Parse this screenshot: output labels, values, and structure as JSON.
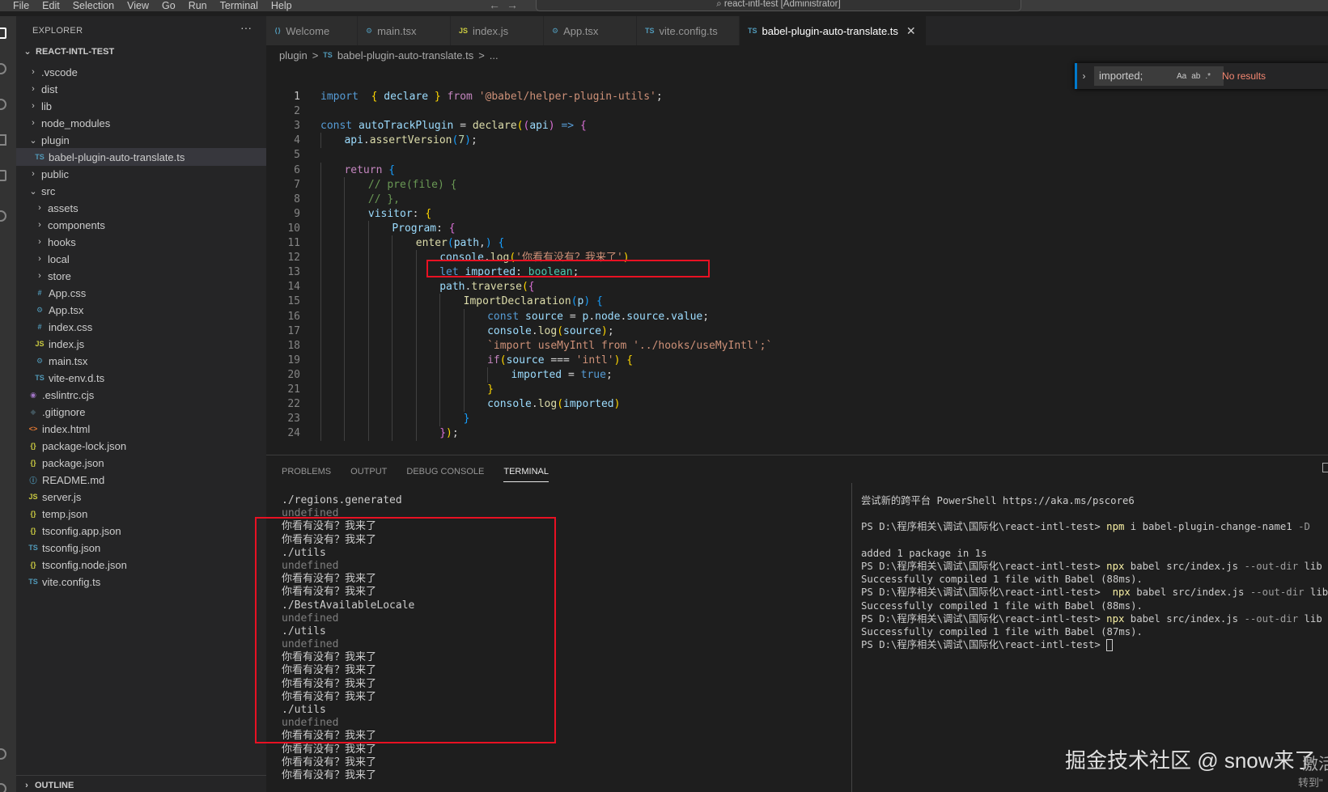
{
  "menubar": {
    "items": [
      "File",
      "Edit",
      "Selection",
      "View",
      "Go",
      "Run",
      "Terminal",
      "Help"
    ],
    "command_center": "react-intl-test [Administrator]"
  },
  "sidebar": {
    "title": "EXPLORER",
    "more": "···",
    "root": "REACT-INTL-TEST",
    "tree": [
      {
        "label": ".vscode",
        "type": "folder",
        "expanded": false,
        "depth": 0
      },
      {
        "label": "dist",
        "type": "folder",
        "expanded": false,
        "depth": 0
      },
      {
        "label": "lib",
        "type": "folder",
        "expanded": false,
        "depth": 0
      },
      {
        "label": "node_modules",
        "type": "folder",
        "expanded": false,
        "depth": 0
      },
      {
        "label": "plugin",
        "type": "folder",
        "expanded": true,
        "depth": 0
      },
      {
        "label": "babel-plugin-auto-translate.ts",
        "type": "file",
        "icon": "TS",
        "iconclass": "ic-ts",
        "depth": 1,
        "selected": true
      },
      {
        "label": "public",
        "type": "folder",
        "expanded": false,
        "depth": 0
      },
      {
        "label": "src",
        "type": "folder",
        "expanded": true,
        "depth": 0
      },
      {
        "label": "assets",
        "type": "folder",
        "expanded": false,
        "depth": 1
      },
      {
        "label": "components",
        "type": "folder",
        "expanded": false,
        "depth": 1
      },
      {
        "label": "hooks",
        "type": "folder",
        "expanded": false,
        "depth": 1
      },
      {
        "label": "local",
        "type": "folder",
        "expanded": false,
        "depth": 1
      },
      {
        "label": "store",
        "type": "folder",
        "expanded": false,
        "depth": 1
      },
      {
        "label": "App.css",
        "type": "file",
        "icon": "#",
        "iconclass": "ic-css",
        "depth": 1
      },
      {
        "label": "App.tsx",
        "type": "file",
        "icon": "⚙",
        "iconclass": "ic-tsx",
        "depth": 1
      },
      {
        "label": "index.css",
        "type": "file",
        "icon": "#",
        "iconclass": "ic-css",
        "depth": 1
      },
      {
        "label": "index.js",
        "type": "file",
        "icon": "JS",
        "iconclass": "ic-js",
        "depth": 1
      },
      {
        "label": "main.tsx",
        "type": "file",
        "icon": "⚙",
        "iconclass": "ic-tsx",
        "depth": 1
      },
      {
        "label": "vite-env.d.ts",
        "type": "file",
        "icon": "TS",
        "iconclass": "ic-ts",
        "depth": 1
      },
      {
        "label": ".eslintrc.cjs",
        "type": "file",
        "icon": "◉",
        "iconclass": "ic-eslint",
        "depth": 0
      },
      {
        "label": ".gitignore",
        "type": "file",
        "icon": "◆",
        "iconclass": "ic-git",
        "depth": 0
      },
      {
        "label": "index.html",
        "type": "file",
        "icon": "<>",
        "iconclass": "ic-html",
        "depth": 0
      },
      {
        "label": "package-lock.json",
        "type": "file",
        "icon": "{}",
        "iconclass": "ic-json",
        "depth": 0
      },
      {
        "label": "package.json",
        "type": "file",
        "icon": "{}",
        "iconclass": "ic-json",
        "depth": 0
      },
      {
        "label": "README.md",
        "type": "file",
        "icon": "ⓘ",
        "iconclass": "ic-info",
        "depth": 0
      },
      {
        "label": "server.js",
        "type": "file",
        "icon": "JS",
        "iconclass": "ic-js",
        "depth": 0
      },
      {
        "label": "temp.json",
        "type": "file",
        "icon": "{}",
        "iconclass": "ic-json",
        "depth": 0
      },
      {
        "label": "tsconfig.app.json",
        "type": "file",
        "icon": "{}",
        "iconclass": "ic-json",
        "depth": 0
      },
      {
        "label": "tsconfig.json",
        "type": "file",
        "icon": "TS",
        "iconclass": "ic-ts",
        "depth": 0
      },
      {
        "label": "tsconfig.node.json",
        "type": "file",
        "icon": "{}",
        "iconclass": "ic-json",
        "depth": 0
      },
      {
        "label": "vite.config.ts",
        "type": "file",
        "icon": "TS",
        "iconclass": "ic-ts",
        "depth": 0
      }
    ],
    "outline": "OUTLINE"
  },
  "tabs": [
    {
      "label": "Welcome",
      "icon": "⟨⟩",
      "active": false
    },
    {
      "label": "main.tsx",
      "icon": "⚙",
      "active": false
    },
    {
      "label": "index.js",
      "icon": "JS",
      "active": false
    },
    {
      "label": "App.tsx",
      "icon": "⚙",
      "active": false
    },
    {
      "label": "vite.config.ts",
      "icon": "TS",
      "active": false
    },
    {
      "label": "babel-plugin-auto-translate.ts",
      "icon": "TS",
      "active": true
    }
  ],
  "breadcrumb": [
    "plugin",
    ">",
    "TS",
    "babel-plugin-auto-translate.ts",
    ">",
    "..."
  ],
  "find": {
    "query": "imported;",
    "options": [
      "Aa",
      "ab",
      ".*"
    ],
    "result": "No results"
  },
  "editor": {
    "current_line": 1,
    "lines": [
      {
        "n": 1,
        "indent": 0,
        "tokens": [
          [
            "k",
            "import"
          ],
          [
            "p",
            "  "
          ],
          [
            "b1",
            "{"
          ],
          [
            "p",
            " "
          ],
          [
            "v",
            "declare"
          ],
          [
            "p",
            " "
          ],
          [
            "b1",
            "}"
          ],
          [
            "p",
            " "
          ],
          [
            "kc",
            "from"
          ],
          [
            "p",
            " "
          ],
          [
            "s",
            "'@babel/helper-plugin-utils'"
          ],
          [
            "p",
            ";"
          ]
        ]
      },
      {
        "n": 2,
        "indent": 0,
        "tokens": []
      },
      {
        "n": 3,
        "indent": 0,
        "tokens": [
          [
            "k",
            "const"
          ],
          [
            "p",
            " "
          ],
          [
            "v",
            "autoTrackPlugin"
          ],
          [
            "p",
            " = "
          ],
          [
            "f",
            "declare"
          ],
          [
            "b1",
            "("
          ],
          [
            "b2",
            "("
          ],
          [
            "v",
            "api"
          ],
          [
            "b2",
            ")"
          ],
          [
            "p",
            " "
          ],
          [
            "k",
            "=>"
          ],
          [
            "p",
            " "
          ],
          [
            "b2",
            "{"
          ]
        ]
      },
      {
        "n": 4,
        "indent": 1,
        "tokens": [
          [
            "v",
            "api"
          ],
          [
            "p",
            "."
          ],
          [
            "f",
            "assertVersion"
          ],
          [
            "b3",
            "("
          ],
          [
            "n",
            "7"
          ],
          [
            "b3",
            ")"
          ],
          [
            "p",
            ";"
          ]
        ]
      },
      {
        "n": 5,
        "indent": 0,
        "tokens": []
      },
      {
        "n": 6,
        "indent": 1,
        "tokens": [
          [
            "kc",
            "return"
          ],
          [
            "p",
            " "
          ],
          [
            "b3",
            "{"
          ]
        ]
      },
      {
        "n": 7,
        "indent": 2,
        "tokens": [
          [
            "c",
            "// pre(file) {"
          ]
        ]
      },
      {
        "n": 8,
        "indent": 2,
        "tokens": [
          [
            "c",
            "// },"
          ]
        ]
      },
      {
        "n": 9,
        "indent": 2,
        "tokens": [
          [
            "v",
            "visitor"
          ],
          [
            "p",
            ": "
          ],
          [
            "b1",
            "{"
          ]
        ]
      },
      {
        "n": 10,
        "indent": 3,
        "tokens": [
          [
            "v",
            "Program"
          ],
          [
            "p",
            ": "
          ],
          [
            "b2",
            "{"
          ]
        ]
      },
      {
        "n": 11,
        "indent": 4,
        "tokens": [
          [
            "f",
            "enter"
          ],
          [
            "b3",
            "("
          ],
          [
            "v",
            "path"
          ],
          [
            "p",
            ","
          ],
          [
            "b3",
            ")"
          ],
          [
            "p",
            " "
          ],
          [
            "b3",
            "{"
          ]
        ]
      },
      {
        "n": 12,
        "indent": 5,
        "tokens": [
          [
            "v",
            "console"
          ],
          [
            "p",
            "."
          ],
          [
            "f",
            "log"
          ],
          [
            "b1",
            "("
          ],
          [
            "s",
            "'你看有没有？我来了'"
          ],
          [
            "b1",
            ")"
          ]
        ]
      },
      {
        "n": 13,
        "indent": 5,
        "tokens": [
          [
            "k",
            "let"
          ],
          [
            "p",
            " "
          ],
          [
            "v",
            "imported"
          ],
          [
            "p",
            ": "
          ],
          [
            "t",
            "boolean"
          ],
          [
            "p",
            ";"
          ]
        ]
      },
      {
        "n": 14,
        "indent": 5,
        "tokens": [
          [
            "v",
            "path"
          ],
          [
            "p",
            "."
          ],
          [
            "f",
            "traverse"
          ],
          [
            "b1",
            "("
          ],
          [
            "b2",
            "{"
          ]
        ]
      },
      {
        "n": 15,
        "indent": 6,
        "tokens": [
          [
            "f",
            "ImportDeclaration"
          ],
          [
            "b3",
            "("
          ],
          [
            "v",
            "p"
          ],
          [
            "b3",
            ")"
          ],
          [
            "p",
            " "
          ],
          [
            "b3",
            "{"
          ]
        ]
      },
      {
        "n": 16,
        "indent": 7,
        "tokens": [
          [
            "k",
            "const"
          ],
          [
            "p",
            " "
          ],
          [
            "v",
            "source"
          ],
          [
            "p",
            " = "
          ],
          [
            "v",
            "p"
          ],
          [
            "p",
            "."
          ],
          [
            "v",
            "node"
          ],
          [
            "p",
            "."
          ],
          [
            "v",
            "source"
          ],
          [
            "p",
            "."
          ],
          [
            "v",
            "value"
          ],
          [
            "p",
            ";"
          ]
        ]
      },
      {
        "n": 17,
        "indent": 7,
        "tokens": [
          [
            "v",
            "console"
          ],
          [
            "p",
            "."
          ],
          [
            "f",
            "log"
          ],
          [
            "b1",
            "("
          ],
          [
            "v",
            "source"
          ],
          [
            "b1",
            ")"
          ],
          [
            "p",
            ";"
          ]
        ]
      },
      {
        "n": 18,
        "indent": 7,
        "tokens": [
          [
            "s",
            "`import useMyIntl from '../hooks/useMyIntl';`"
          ]
        ]
      },
      {
        "n": 19,
        "indent": 7,
        "tokens": [
          [
            "kc",
            "if"
          ],
          [
            "b1",
            "("
          ],
          [
            "v",
            "source"
          ],
          [
            "p",
            " === "
          ],
          [
            "s",
            "'intl'"
          ],
          [
            "b1",
            ")"
          ],
          [
            "p",
            " "
          ],
          [
            "b1",
            "{"
          ]
        ]
      },
      {
        "n": 20,
        "indent": 8,
        "tokens": [
          [
            "v",
            "imported"
          ],
          [
            "p",
            " = "
          ],
          [
            "k",
            "true"
          ],
          [
            "p",
            ";"
          ]
        ]
      },
      {
        "n": 21,
        "indent": 7,
        "tokens": [
          [
            "b1",
            "}"
          ]
        ]
      },
      {
        "n": 22,
        "indent": 7,
        "tokens": [
          [
            "v",
            "console"
          ],
          [
            "p",
            "."
          ],
          [
            "f",
            "log"
          ],
          [
            "b1",
            "("
          ],
          [
            "v",
            "imported"
          ],
          [
            "b1",
            ")"
          ]
        ]
      },
      {
        "n": 23,
        "indent": 6,
        "tokens": [
          [
            "b3",
            "}"
          ]
        ]
      },
      {
        "n": 24,
        "indent": 5,
        "tokens": [
          [
            "b2",
            "}"
          ],
          [
            "b1",
            ")"
          ],
          [
            "p",
            ";"
          ]
        ]
      }
    ]
  },
  "panel": {
    "tabs": [
      {
        "label": "PROBLEMS",
        "active": false
      },
      {
        "label": "OUTPUT",
        "active": false
      },
      {
        "label": "DEBUG CONSOLE",
        "active": false
      },
      {
        "label": "TERMINAL",
        "active": true
      }
    ],
    "terminal_left": [
      {
        "text": "./regions.generated",
        "dim": false
      },
      {
        "text": "undefined",
        "dim": true
      },
      {
        "text": "你看有没有？我来了",
        "dim": false
      },
      {
        "text": "你看有没有？我来了",
        "dim": false
      },
      {
        "text": "./utils",
        "dim": false
      },
      {
        "text": "undefined",
        "dim": true
      },
      {
        "text": "你看有没有？我来了",
        "dim": false
      },
      {
        "text": "你看有没有？我来了",
        "dim": false
      },
      {
        "text": "./BestAvailableLocale",
        "dim": false
      },
      {
        "text": "undefined",
        "dim": true
      },
      {
        "text": "./utils",
        "dim": false
      },
      {
        "text": "undefined",
        "dim": true
      },
      {
        "text": "你看有没有？我来了",
        "dim": false
      },
      {
        "text": "你看有没有？我来了",
        "dim": false
      },
      {
        "text": "你看有没有？我来了",
        "dim": false
      },
      {
        "text": "你看有没有？我来了",
        "dim": false
      },
      {
        "text": "./utils",
        "dim": false
      },
      {
        "text": "undefined",
        "dim": true
      },
      {
        "text": "你看有没有？我来了",
        "dim": false
      },
      {
        "text": "你看有没有？我来了",
        "dim": false
      },
      {
        "text": "你看有没有？我来了",
        "dim": false
      },
      {
        "text": "你看有没有？我来了",
        "dim": false
      }
    ],
    "terminal_right": [
      [
        [
          "p",
          "尝试新的跨平台 PowerShell https://aka.ms/pscore6"
        ]
      ],
      [],
      [
        [
          "p",
          "PS D:\\程序相关\\调试\\国际化\\react-intl-test> "
        ],
        [
          "hl",
          "npm"
        ],
        [
          "p",
          " i babel-plugin-change-name1 "
        ],
        [
          "gray",
          "-D"
        ]
      ],
      [],
      [
        [
          "p",
          "added 1 package in 1s"
        ]
      ],
      [
        [
          "p",
          "PS D:\\程序相关\\调试\\国际化\\react-intl-test> "
        ],
        [
          "hl",
          "npx"
        ],
        [
          "p",
          " babel src/index.js "
        ],
        [
          "gray",
          "--out-dir"
        ],
        [
          "p",
          " lib"
        ]
      ],
      [
        [
          "p",
          "Successfully compiled 1 file with Babel (88ms)."
        ]
      ],
      [
        [
          "p",
          "PS D:\\程序相关\\调试\\国际化\\react-intl-test>  "
        ],
        [
          "hl",
          "npx"
        ],
        [
          "p",
          " babel src/index.js "
        ],
        [
          "gray",
          "--out-dir"
        ],
        [
          "p",
          " lib"
        ]
      ],
      [
        [
          "p",
          "Successfully compiled 1 file with Babel (88ms)."
        ]
      ],
      [
        [
          "p",
          "PS D:\\程序相关\\调试\\国际化\\react-intl-test> "
        ],
        [
          "hl",
          "npx"
        ],
        [
          "p",
          " babel src/index.js "
        ],
        [
          "gray",
          "--out-dir"
        ],
        [
          "p",
          " lib"
        ]
      ],
      [
        [
          "p",
          "Successfully compiled 1 file with Babel (87ms)."
        ]
      ],
      [
        [
          "p",
          "PS D:\\程序相关\\调试\\国际化\\react-intl-test> "
        ],
        [
          "cursor",
          ""
        ]
      ]
    ]
  },
  "watermark": {
    "text": "掘金技术社区 @ snow来了",
    "corner1": "激活",
    "corner2": "转到\""
  }
}
